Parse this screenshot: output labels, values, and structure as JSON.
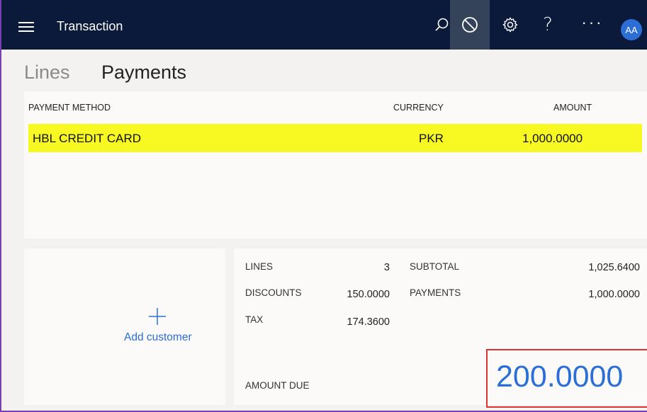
{
  "header": {
    "title": "Transaction",
    "avatar_initials": "AA",
    "more_label": "···",
    "help_label": "?"
  },
  "tabs": [
    {
      "label": "Lines",
      "selected": false
    },
    {
      "label": "Payments",
      "selected": true
    }
  ],
  "payments_table": {
    "columns": [
      "PAYMENT METHOD",
      "CURRENCY",
      "AMOUNT"
    ],
    "rows": [
      {
        "method": "HBL CREDIT CARD",
        "currency": "PKR",
        "amount": "1,000.0000",
        "selected": true
      }
    ]
  },
  "customer": {
    "add_label": "Add customer"
  },
  "totals": {
    "lines_label": "LINES",
    "lines_value": "3",
    "discounts_label": "DISCOUNTS",
    "discounts_value": "150.0000",
    "tax_label": "TAX",
    "tax_value": "174.3600",
    "subtotal_label": "SUBTOTAL",
    "subtotal_value": "1,025.6400",
    "payments_label": "PAYMENTS",
    "payments_value": "1,000.0000",
    "amount_due_label": "AMOUNT DUE",
    "amount_due_value": "200.0000"
  },
  "colors": {
    "topbar": "#0b1a3a",
    "selected_row": "#f8f822",
    "accent": "#2b6fd6",
    "highlight_border": "#dd3333"
  }
}
